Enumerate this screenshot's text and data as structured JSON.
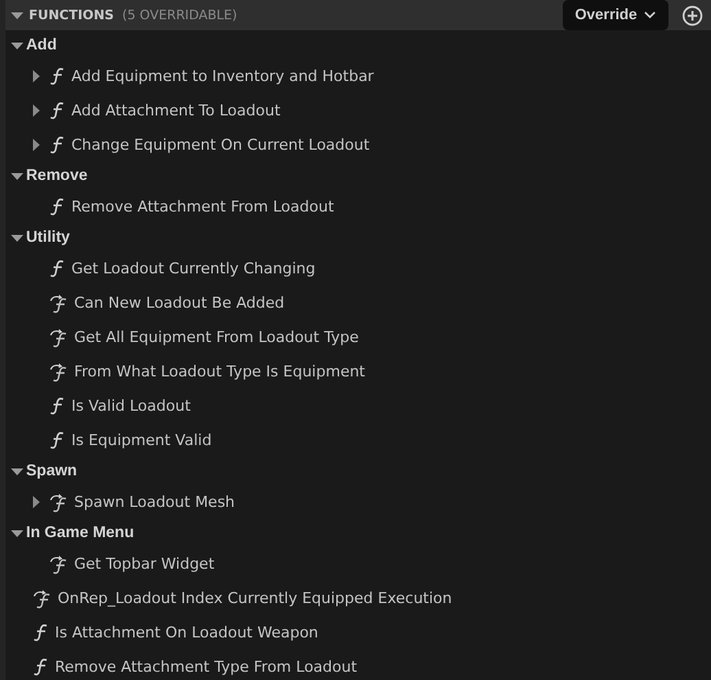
{
  "header": {
    "title": "FUNCTIONS",
    "count": "(5 OVERRIDABLE)",
    "expanded": true,
    "override_button": "Override"
  },
  "items": [
    {
      "kind": "category",
      "label": "Add",
      "expanded": true,
      "children": [
        {
          "kind": "pure_function",
          "label": "Add Equipment to Inventory and Hotbar",
          "expanded": false
        },
        {
          "kind": "pure_function",
          "label": "Add Attachment To Loadout",
          "expanded": false
        },
        {
          "kind": "pure_function",
          "label": "Change Equipment On Current Loadout",
          "expanded": false
        }
      ]
    },
    {
      "kind": "category",
      "label": "Remove",
      "expanded": true,
      "children": [
        {
          "kind": "pure_function",
          "label": "Remove Attachment From Loadout"
        }
      ]
    },
    {
      "kind": "category",
      "label": "Utility",
      "expanded": true,
      "children": [
        {
          "kind": "pure_function",
          "label": "Get Loadout Currently Changing"
        },
        {
          "kind": "function",
          "label": "Can New Loadout Be Added"
        },
        {
          "kind": "function",
          "label": "Get All Equipment From Loadout Type"
        },
        {
          "kind": "function",
          "label": "From What Loadout Type Is Equipment"
        },
        {
          "kind": "pure_function",
          "label": "Is Valid Loadout"
        },
        {
          "kind": "pure_function",
          "label": "Is Equipment Valid"
        }
      ]
    },
    {
      "kind": "category",
      "label": "Spawn",
      "expanded": true,
      "children": [
        {
          "kind": "function",
          "label": "Spawn Loadout Mesh",
          "expanded": false
        }
      ]
    },
    {
      "kind": "category",
      "label": "In Game Menu",
      "expanded": true,
      "children": [
        {
          "kind": "function",
          "label": "Get Topbar Widget"
        }
      ]
    },
    {
      "kind": "function",
      "label": "OnRep_Loadout Index Currently Equipped Execution"
    },
    {
      "kind": "pure_function",
      "label": "Is Attachment On Loadout Weapon"
    },
    {
      "kind": "pure_function",
      "label": "Remove Attachment Type From Loadout"
    }
  ]
}
